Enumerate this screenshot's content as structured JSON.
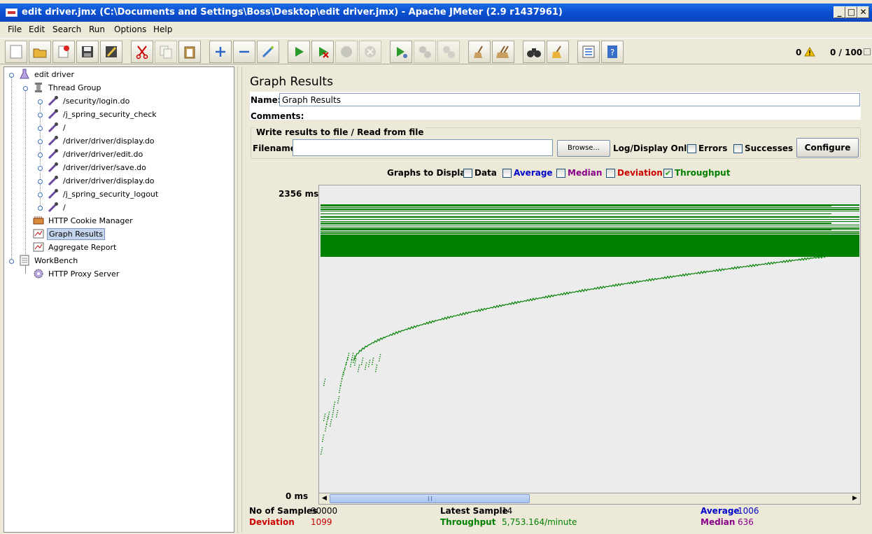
{
  "window": {
    "title": "edit driver.jmx (C:\\Documents and Settings\\Boss\\Desktop\\edit driver.jmx) - Apache JMeter (2.9 r1437961)",
    "min_label": "_",
    "max_label": "□",
    "close_label": "✕"
  },
  "menu": {
    "file": "File",
    "edit": "Edit",
    "search": "Search",
    "run": "Run",
    "options": "Options",
    "help": "Help"
  },
  "toolbar": {
    "warning_count": "0",
    "threads": "0 / 100"
  },
  "tree": {
    "root": "edit driver",
    "thread_group": "Thread Group",
    "samplers": [
      "/security/login.do",
      "/j_spring_security_check",
      "/",
      "/driver/driver/display.do",
      "/driver/driver/edit.do",
      "/driver/driver/save.do",
      "/driver/driver/display.do",
      "/j_spring_security_logout",
      "/"
    ],
    "cookie_manager": "HTTP Cookie Manager",
    "graph_results": "Graph Results",
    "aggregate_report": "Aggregate Report",
    "workbench": "WorkBench",
    "proxy_server": "HTTP Proxy Server"
  },
  "panel": {
    "title": "Graph Results",
    "name_label": "Name:",
    "name_value": "Graph Results",
    "comments_label": "Comments:",
    "file_group_title": "Write results to file / Read from file",
    "filename_label": "Filename",
    "filename_value": "",
    "browse_label": "Browse...",
    "log_display_label": "Log/Display Only:",
    "errors_label": "Errors",
    "successes_label": "Successes",
    "configure_label": "Configure",
    "graphs_to_display_label": "Graphs to Display",
    "graph_options": [
      {
        "label": "Data",
        "checked": false,
        "color": "#000000"
      },
      {
        "label": "Average",
        "checked": false,
        "color": "#0000cc"
      },
      {
        "label": "Median",
        "checked": false,
        "color": "#880088"
      },
      {
        "label": "Deviation",
        "checked": false,
        "color": "#cc0000"
      },
      {
        "label": "Throughput",
        "checked": true,
        "color": "#008000"
      }
    ]
  },
  "graph": {
    "y_max_label": "2356  ms",
    "y_min_label": "0  ms",
    "throughput_color": "#008000"
  },
  "stats": {
    "samples_label": "No of Samples",
    "samples_value": "90000",
    "deviation_label": "Deviation",
    "deviation_value": "1099",
    "latest_label": "Latest Sample",
    "latest_value": "14",
    "throughput_label": "Throughput",
    "throughput_value": "5,753.164/minute",
    "average_label": "Average",
    "average_value": "1006",
    "median_label": "Median",
    "median_value": "636",
    "colors": {
      "black": "#000000",
      "red": "#cc0000",
      "green": "#008000",
      "blue": "#0000cc",
      "purple": "#880088"
    }
  }
}
